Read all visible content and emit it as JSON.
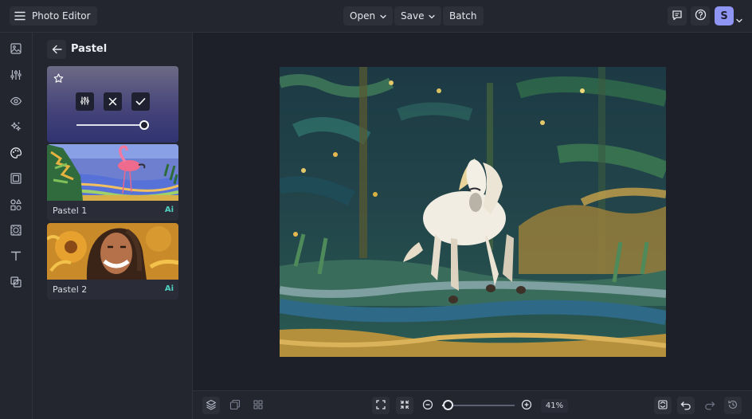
{
  "app": {
    "title": "Photo Editor"
  },
  "toolbar": {
    "open_label": "Open",
    "save_label": "Save",
    "batch_label": "Batch"
  },
  "user": {
    "initial": "S",
    "accent": "#8f95f2"
  },
  "sidebar": {
    "items": [
      {
        "icon": "image-icon"
      },
      {
        "icon": "adjustments-icon"
      },
      {
        "icon": "eye-icon"
      },
      {
        "icon": "magic-wand-icon"
      },
      {
        "icon": "palette-icon"
      },
      {
        "icon": "frame-icon"
      },
      {
        "icon": "shapes-icon"
      },
      {
        "icon": "texture-icon"
      },
      {
        "icon": "text-icon"
      },
      {
        "icon": "graphics-icon"
      }
    ]
  },
  "panel": {
    "title": "Pastel",
    "active_card": {
      "intensity": 1.0
    },
    "effects": [
      {
        "name": "Pastel 1",
        "badge": "Ai"
      },
      {
        "name": "Pastel 2",
        "badge": "Ai"
      }
    ]
  },
  "zoom": {
    "value": "41%",
    "slider_fraction": 0.04
  },
  "colors": {
    "background": "#1e2029",
    "panel": "#23252f",
    "ai_badge": "#4fd2c2"
  }
}
